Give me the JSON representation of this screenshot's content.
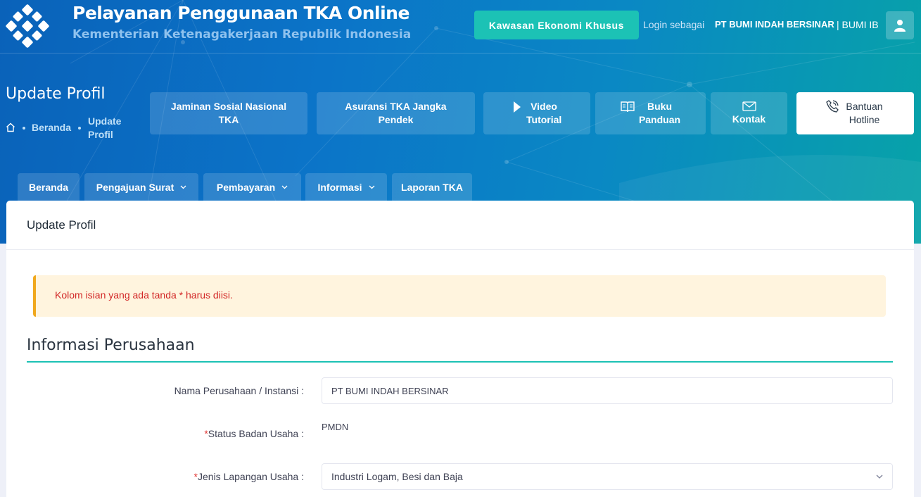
{
  "header": {
    "title": "Pelayanan Penggunaan TKA Online",
    "subtitle": "Kementerian Ketenagakerjaan Republik Indonesia",
    "kek_button": "Kawasan Ekonomi Khusus",
    "login_prefix": "Login sebagai",
    "company": "PT BUMI INDAH BERSINAR",
    "user": "| BUMI IB",
    "avatar_icon": "user-icon",
    "logo_icon": "kemnaker-logo-icon"
  },
  "page": {
    "heading": "Update Profil",
    "breadcrumb": {
      "home_icon": "home-icon",
      "link": "Beranda",
      "current": "Update Profil"
    }
  },
  "quick_links": [
    {
      "label": "Jaminan Sosial Nasional TKA",
      "icon": ""
    },
    {
      "label": "Asuransi TKA Jangka Pendek",
      "icon": ""
    },
    {
      "label": "Video Tutorial",
      "icon": "play-icon"
    },
    {
      "label": "Buku Panduan",
      "icon": "book-icon"
    },
    {
      "label": "Kontak",
      "icon": "mail-icon"
    },
    {
      "label": "Bantuan Hotline",
      "icon": "phone-icon"
    }
  ],
  "nav": [
    {
      "label": "Beranda",
      "dropdown": false
    },
    {
      "label": "Pengajuan Surat",
      "dropdown": true
    },
    {
      "label": "Pembayaran",
      "dropdown": true
    },
    {
      "label": "Informasi",
      "dropdown": true
    },
    {
      "label": "Laporan TKA",
      "dropdown": false
    }
  ],
  "card": {
    "title": "Update Profil",
    "alert": "Kolom isian yang ada tanda * harus diisi.",
    "section_title": "Informasi Perusahaan",
    "fields": {
      "nama": {
        "label": "Nama Perusahaan / Instansi :",
        "value": "PT BUMI INDAH BERSINAR"
      },
      "status": {
        "required_mark": "*",
        "label": "Status Badan Usaha :",
        "value": "PMDN"
      },
      "jenis": {
        "required_mark": "*",
        "label": "Jenis Lapangan Usaha :",
        "value": "Industri Logam, Besi dan Baja"
      }
    }
  },
  "colors": {
    "accent": "#1cc2b5",
    "primary": "#0a62b9",
    "alert_bg": "#fff4de",
    "alert_border": "#f0a81d",
    "alert_text": "#d22626"
  }
}
